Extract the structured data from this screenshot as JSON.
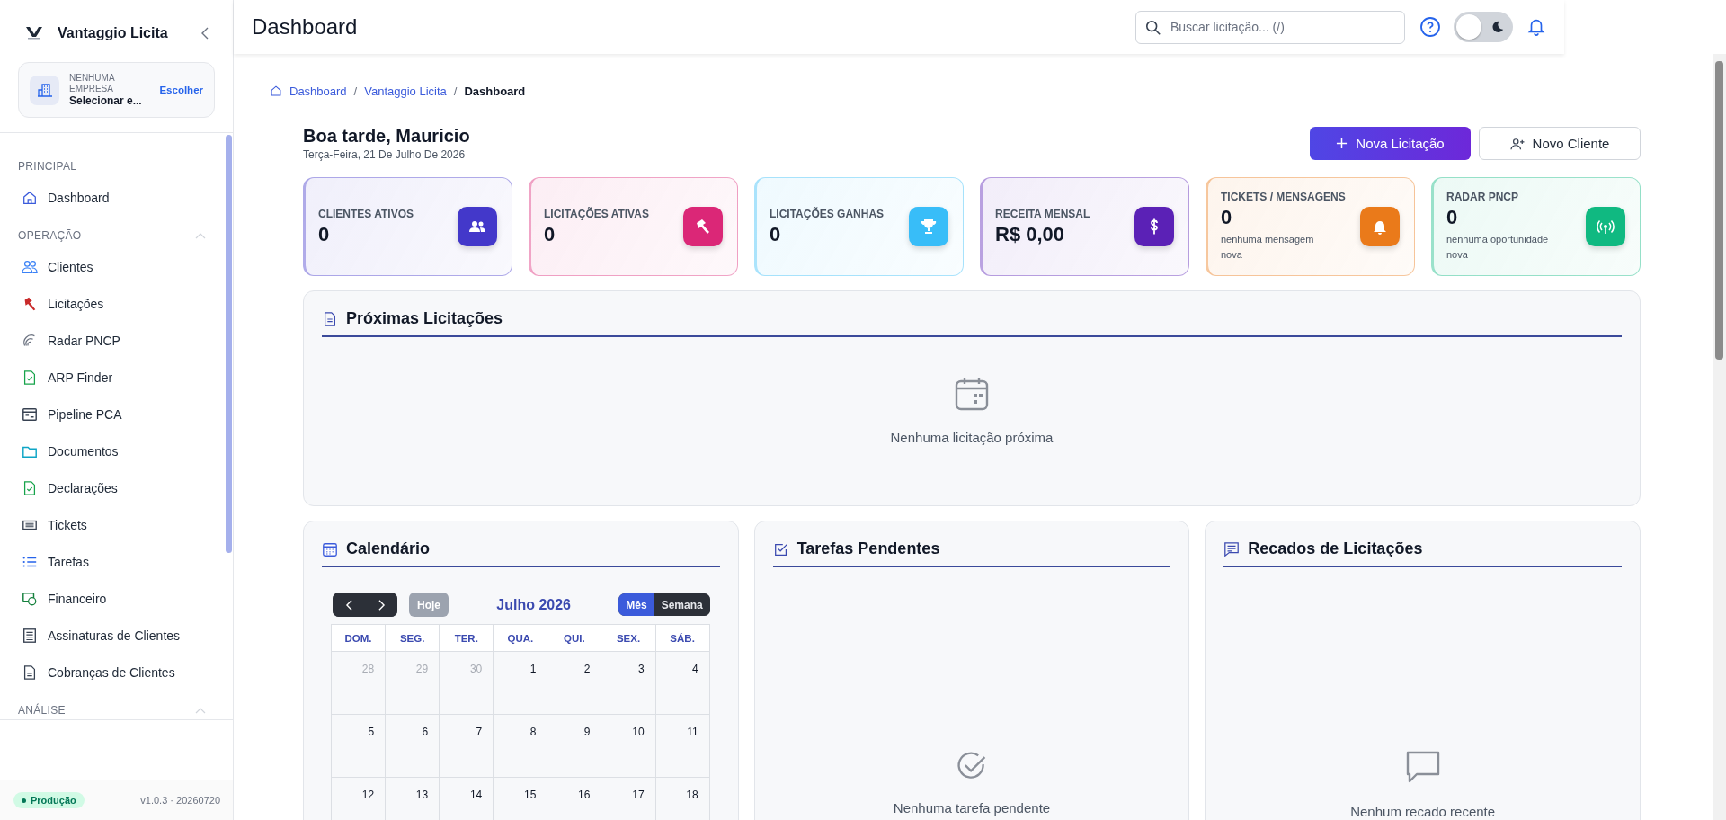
{
  "sidebar": {
    "brand": "Vantaggio Licita",
    "company": {
      "label": "NENHUMA EMPRESA",
      "name": "Selecionar e...",
      "action": "Escolher"
    },
    "sections": [
      {
        "title": "PRINCIPAL",
        "collapsible": false,
        "items": [
          {
            "label": "Dashboard",
            "selected": false
          }
        ]
      },
      {
        "title": "OPERAÇÃO",
        "collapsible": true,
        "expanded": true,
        "items": [
          {
            "label": "Clientes",
            "selected": false
          },
          {
            "label": "Licitações",
            "selected": false
          },
          {
            "label": "Radar PNCP",
            "selected": false
          },
          {
            "label": "ARP Finder",
            "selected": false
          },
          {
            "label": "Pipeline PCA",
            "selected": false
          },
          {
            "label": "Documentos",
            "selected": false
          },
          {
            "label": "Declarações",
            "selected": false
          },
          {
            "label": "Tickets",
            "selected": false
          },
          {
            "label": "Tarefas",
            "selected": false
          },
          {
            "label": "Financeiro",
            "selected": false
          },
          {
            "label": "Assinaturas de Clientes",
            "selected": false
          },
          {
            "label": "Cobranças de Clientes",
            "selected": false
          }
        ]
      },
      {
        "title": "ANÁLISE",
        "collapsible": true,
        "expanded": true
      }
    ],
    "environment": "Produção",
    "version": "v1.0.3 · 20260720"
  },
  "header": {
    "title": "Dashboard",
    "search": {
      "placeholder": "Buscar licitação... (/)"
    },
    "theme_toggle": {
      "on": false
    }
  },
  "breadcrumbs": [
    {
      "label": "Dashboard",
      "kind": "link"
    },
    {
      "label": "/",
      "kind": "separator"
    },
    {
      "label": "Vantaggio Licita",
      "kind": "link"
    },
    {
      "label": "/",
      "kind": "separator"
    },
    {
      "label": "Dashboard",
      "kind": "current"
    }
  ],
  "greeting": {
    "title": "Boa tarde, Mauricio",
    "date": "Terça-Feira, 21 De Julho De 2026"
  },
  "actions": [
    {
      "label": "Nova Licitação",
      "kind": "primary"
    },
    {
      "label": "Novo Cliente",
      "kind": "secondary"
    }
  ],
  "stats": [
    {
      "label": "CLIENTES ATIVOS",
      "value": "0",
      "color": "#4338ca"
    },
    {
      "label": "LICITAÇÕES ATIVAS",
      "value": "0",
      "color": "#db2777"
    },
    {
      "label": "LICITAÇÕES GANHAS",
      "value": "0",
      "color": "#38bdf8"
    },
    {
      "label": "RECEITA MENSAL",
      "value": "R$ 0,00",
      "color": "#5b21b6"
    },
    {
      "label": "TICKETS / MENSAGENS",
      "value": "0",
      "note": "nenhuma mensagem nova",
      "color": "#ea7a1a"
    },
    {
      "label": "RADAR PNCP",
      "value": "0",
      "note": "nenhuma oportunidade nova",
      "color": "#10b981"
    }
  ],
  "upcoming": {
    "title": "Próximas Licitações",
    "empty": "Nenhuma licitação próxima"
  },
  "calendar": {
    "title": "Calendário",
    "month": "Julho 2026",
    "today": {
      "label": "Hoje",
      "disabled": true
    },
    "views": [
      {
        "label": "Mês",
        "selected": true
      },
      {
        "label": "Semana",
        "selected": false
      }
    ],
    "weekdays": [
      "DOM.",
      "SEG.",
      "TER.",
      "QUA.",
      "QUI.",
      "SEX.",
      "SÁB."
    ],
    "weeks": [
      [
        {
          "day": "28",
          "muted": true
        },
        {
          "day": "29",
          "muted": true
        },
        {
          "day": "30",
          "muted": true
        },
        {
          "day": "1",
          "muted": false
        },
        {
          "day": "2",
          "muted": false
        },
        {
          "day": "3",
          "muted": false
        },
        {
          "day": "4",
          "muted": false
        }
      ],
      [
        {
          "day": "5",
          "muted": false
        },
        {
          "day": "6",
          "muted": false
        },
        {
          "day": "7",
          "muted": false
        },
        {
          "day": "8",
          "muted": false
        },
        {
          "day": "9",
          "muted": false
        },
        {
          "day": "10",
          "muted": false
        },
        {
          "day": "11",
          "muted": false
        }
      ],
      [
        {
          "day": "12",
          "muted": false
        },
        {
          "day": "13",
          "muted": false
        },
        {
          "day": "14",
          "muted": false
        },
        {
          "day": "15",
          "muted": false
        },
        {
          "day": "16",
          "muted": false
        },
        {
          "day": "17",
          "muted": false
        },
        {
          "day": "18",
          "muted": false
        }
      ]
    ]
  },
  "tasks": {
    "title": "Tarefas Pendentes",
    "empty": "Nenhuma tarefa pendente"
  },
  "messages": {
    "title": "Recados de Licitações",
    "empty": "Nenhum recado recente"
  }
}
